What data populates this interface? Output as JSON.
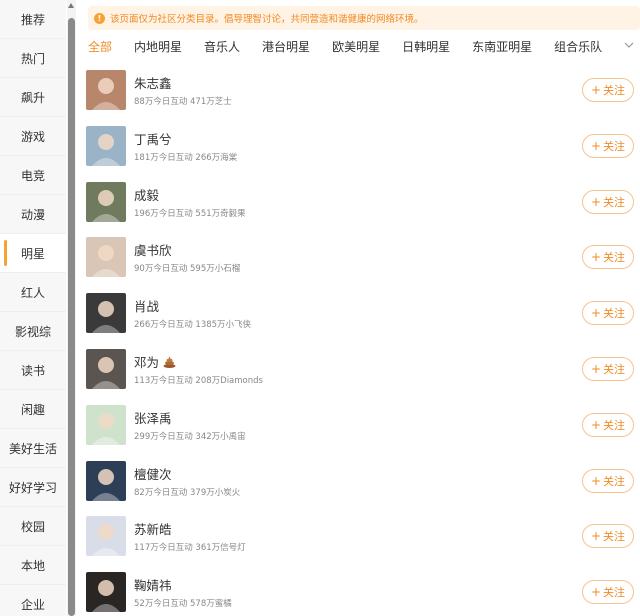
{
  "sidebar": {
    "items": [
      {
        "label": "推荐",
        "active": false
      },
      {
        "label": "热门",
        "active": false
      },
      {
        "label": "飙升",
        "active": false
      },
      {
        "label": "游戏",
        "active": false
      },
      {
        "label": "电竞",
        "active": false
      },
      {
        "label": "动漫",
        "active": false
      },
      {
        "label": "明星",
        "active": true
      },
      {
        "label": "红人",
        "active": false
      },
      {
        "label": "影视综",
        "active": false
      },
      {
        "label": "读书",
        "active": false
      },
      {
        "label": "闲趣",
        "active": false
      },
      {
        "label": "美好生活",
        "active": false
      },
      {
        "label": "好好学习",
        "active": false
      },
      {
        "label": "校园",
        "active": false
      },
      {
        "label": "本地",
        "active": false
      },
      {
        "label": "企业",
        "active": false
      }
    ]
  },
  "notice": {
    "icon": "info-icon",
    "icon_glyph": "!",
    "text": "该页面仅为社区分类目录。倡导理智讨论，共同营造和谐健康的网络环境。"
  },
  "tabs": [
    {
      "label": "全部",
      "active": true
    },
    {
      "label": "内地明星",
      "active": false
    },
    {
      "label": "音乐人",
      "active": false
    },
    {
      "label": "港台明星",
      "active": false
    },
    {
      "label": "欧美明星",
      "active": false
    },
    {
      "label": "日韩明星",
      "active": false
    },
    {
      "label": "东南亚明星",
      "active": false
    },
    {
      "label": "组合乐队",
      "active": false
    }
  ],
  "follow_label": "关注",
  "follow_plus": "+",
  "accent_color": "#f08a24",
  "rows": [
    {
      "name": "朱志鑫",
      "stats": "88万今日互动 471万芝士",
      "avatar_color": "#b8866b",
      "badge": ""
    },
    {
      "name": "丁禹兮",
      "stats": "181万今日互动 266万海棠",
      "avatar_color": "#9bb3c7",
      "badge": ""
    },
    {
      "name": "成毅",
      "stats": "196万今日互动 551万奇毅果",
      "avatar_color": "#6f7a5e",
      "badge": ""
    },
    {
      "name": "虞书欣",
      "stats": "90万今日互动 595万小石榴",
      "avatar_color": "#d9c6b6",
      "badge": ""
    },
    {
      "name": "肖战",
      "stats": "266万今日互动 1385万小飞侠",
      "avatar_color": "#3a3a3a",
      "badge": ""
    },
    {
      "name": "邓为",
      "stats": "113万今日互动 208万Diamonds",
      "avatar_color": "#5a5550",
      "badge": "poop-emoji"
    },
    {
      "name": "张泽禹",
      "stats": "299万今日互动 342万小禹宙",
      "avatar_color": "#cfe3cc",
      "badge": ""
    },
    {
      "name": "檀健次",
      "stats": "82万今日互动 379万小炭火",
      "avatar_color": "#2d3e57",
      "badge": ""
    },
    {
      "name": "苏新皓",
      "stats": "117万今日互动 361万信号灯",
      "avatar_color": "#d8dde8",
      "badge": ""
    },
    {
      "name": "鞠婧祎",
      "stats": "52万今日互动 578万蜜橘",
      "avatar_color": "#2a2624",
      "badge": ""
    }
  ]
}
